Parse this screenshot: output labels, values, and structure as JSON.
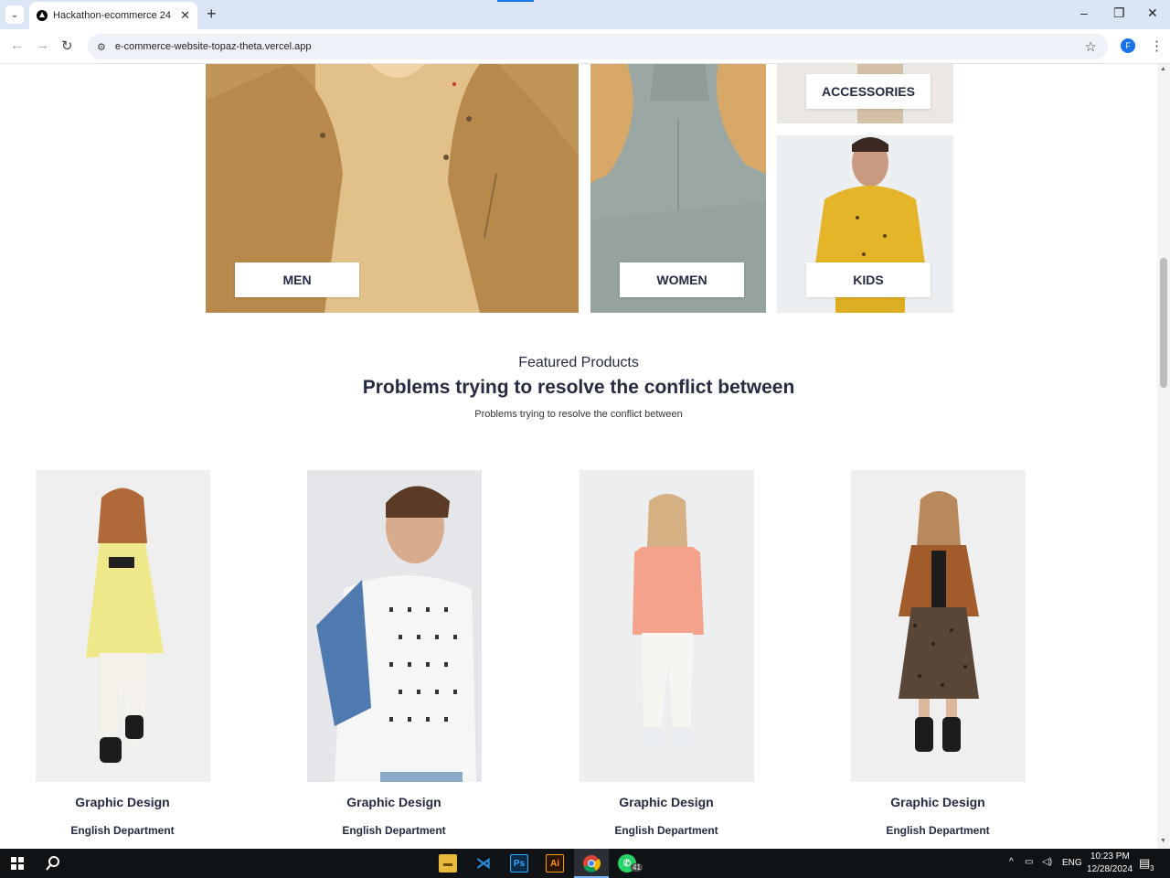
{
  "browser": {
    "tab_title": "Hackathon-ecommerce 24",
    "url": "e-commerce-website-topaz-theta.vercel.app",
    "profile_initial": "F"
  },
  "categories": [
    {
      "key": "men",
      "label": "MEN"
    },
    {
      "key": "women",
      "label": "WOMEN"
    },
    {
      "key": "accessories",
      "label": "ACCESSORIES"
    },
    {
      "key": "kids",
      "label": "KIDS"
    }
  ],
  "featured": {
    "subtitle": "Featured Products",
    "title": "Problems trying to resolve the conflict between",
    "description": "Problems trying to resolve the conflict between"
  },
  "products": [
    {
      "title": "Graphic Design",
      "department": "English Department"
    },
    {
      "title": "Graphic Design",
      "department": "English Department"
    },
    {
      "title": "Graphic Design",
      "department": "English Department"
    },
    {
      "title": "Graphic Design",
      "department": "English Department"
    }
  ],
  "taskbar": {
    "language": "ENG",
    "time": "10:23 PM",
    "date": "12/28/2024",
    "notification_count": "3",
    "whatsapp_badge": "41"
  },
  "colors": {
    "heading": "#252b42",
    "accent_blue": "#1a73e8",
    "tab_strip": "#dbe6f4"
  }
}
